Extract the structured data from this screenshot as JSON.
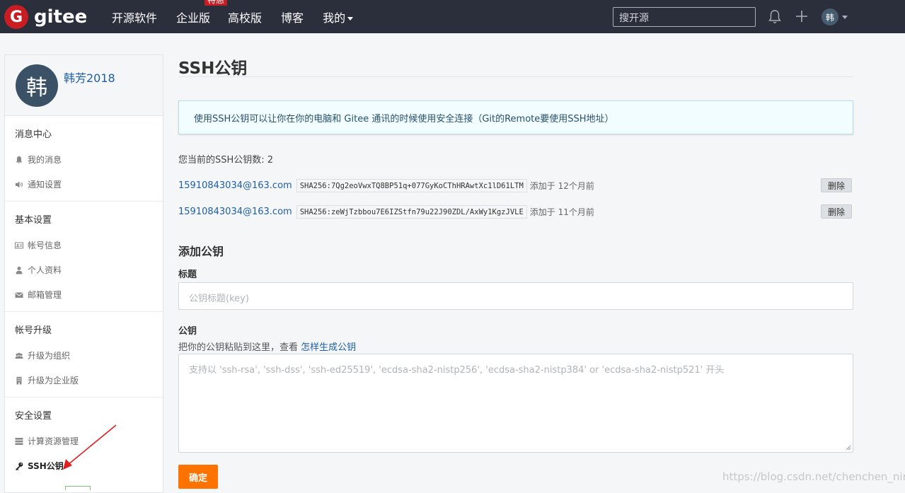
{
  "brand": {
    "logo_letter": "G",
    "logo_text": "gitee"
  },
  "nav": {
    "items": [
      {
        "label": "开源软件"
      },
      {
        "label": "企业版",
        "badge": "特惠"
      },
      {
        "label": "高校版"
      },
      {
        "label": "博客"
      },
      {
        "label": "我的"
      }
    ]
  },
  "search": {
    "placeholder": "搜开源"
  },
  "user": {
    "avatar_char": "韩",
    "name": "韩芳2018"
  },
  "sidebar": {
    "groups": [
      {
        "title": "消息中心",
        "items": [
          {
            "label": "我的消息",
            "icon": "bell-icon"
          },
          {
            "label": "通知设置",
            "icon": "volume-icon"
          }
        ]
      },
      {
        "title": "基本设置",
        "items": [
          {
            "label": "帐号信息",
            "icon": "id-card-icon"
          },
          {
            "label": "个人资料",
            "icon": "user-icon"
          },
          {
            "label": "邮箱管理",
            "icon": "envelope-icon"
          }
        ]
      },
      {
        "title": "帐号升级",
        "items": [
          {
            "label": "升级为组织",
            "icon": "users-icon"
          },
          {
            "label": "升级为企业版",
            "icon": "building-icon"
          }
        ]
      },
      {
        "title": "安全设置",
        "items": [
          {
            "label": "计算资源管理",
            "icon": "server-icon"
          },
          {
            "label": "SSH公钥",
            "icon": "key-icon",
            "active": true
          }
        ]
      }
    ]
  },
  "main": {
    "title": "SSH公钥",
    "info": "使用SSH公钥可以让你在你的电脑和 Gitee 通讯的时候使用安全连接（Git的Remote要使用SSH地址）",
    "key_count": "您当前的SSH公钥数: 2",
    "keys": [
      {
        "email": "15910843034@163.com",
        "fingerprint": "SHA256:7Qg2eoVwxTQ8BP51q+077GyKoCThHRAwtXc1lD61LTM",
        "added": "添加于 12个月前",
        "delete_label": "删除"
      },
      {
        "email": "15910843034@163.com",
        "fingerprint": "SHA256:zeWjTzbbou7E6IZStfn79u22J90ZDL/AxWy1KgzJVLE",
        "added": "添加于 11个月前",
        "delete_label": "删除"
      }
    ],
    "add_title": "添加公钥",
    "title_label": "标题",
    "title_placeholder": "公钥标题(key)",
    "key_label": "公钥",
    "help_text": "把你的公钥粘贴到这里，查看",
    "help_link": "怎样生成公钥",
    "key_placeholder": "支持以 'ssh-rsa', 'ssh-dss', 'ssh-ed25519', 'ecdsa-sha2-nistp256', 'ecdsa-sha2-nistp384' or 'ecdsa-sha2-nistp521' 开头",
    "submit_label": "确定"
  },
  "watermark": "https://blog.csdn.net/chenchen_nini",
  "colors": {
    "topbar": "#2b2e3b",
    "brand_red": "#c71d23",
    "link": "#1e5fa8",
    "primary_button": "#fe7300",
    "annotation_arrow": "#e02020"
  }
}
